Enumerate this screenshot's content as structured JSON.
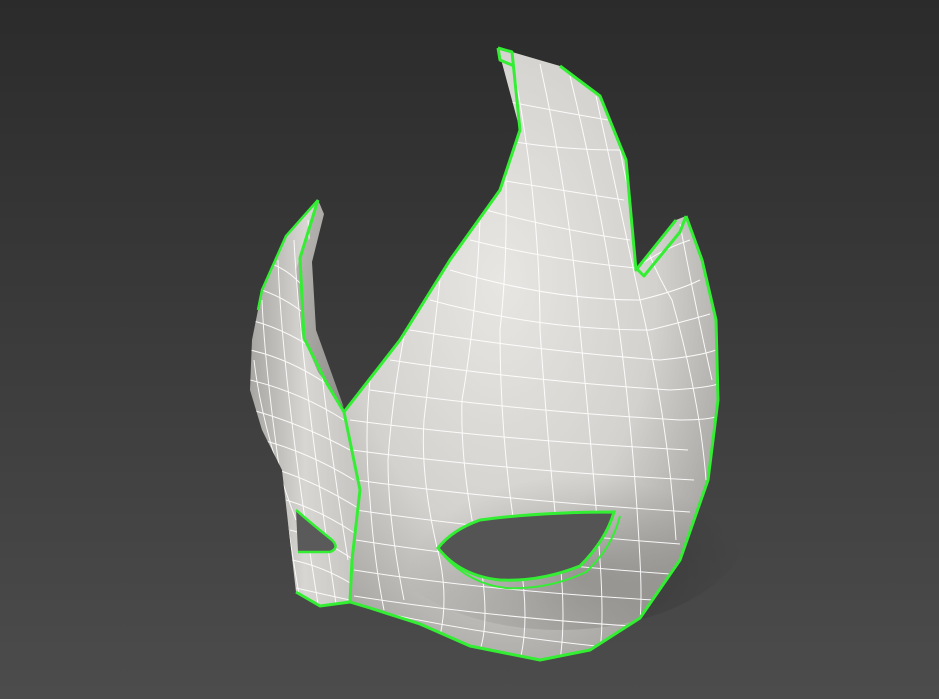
{
  "viewport": {
    "background_top": "#2b2b2b",
    "background_bottom": "#4c4c4c"
  },
  "model": {
    "subject": "carnival-eye-mask",
    "surface_color": "#dcdad6",
    "shadow_color": "#8a8884",
    "wire_color": "#ffffff",
    "selection_edge_color": "#33ee33"
  }
}
